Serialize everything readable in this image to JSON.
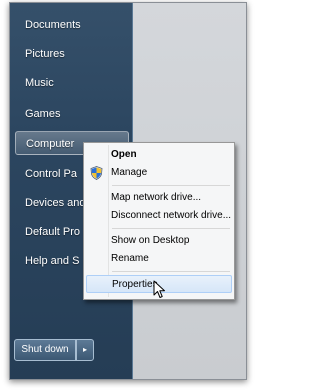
{
  "start_menu": {
    "items": [
      {
        "label": "Documents"
      },
      {
        "label": "Pictures"
      },
      {
        "label": "Music"
      },
      {
        "label": "Games"
      },
      {
        "label": "Computer"
      },
      {
        "label": "Control Pa"
      },
      {
        "label": "Devices and"
      },
      {
        "label": "Default Pro"
      },
      {
        "label": "Help and S"
      }
    ],
    "shutdown_label": "Shut down",
    "shutdown_arrow": "▸"
  },
  "context_menu": {
    "open": "Open",
    "manage": "Manage",
    "map_drive": "Map network drive...",
    "disconnect_drive": "Disconnect network drive...",
    "show_on_desktop": "Show on Desktop",
    "rename": "Rename",
    "properties": "Properties"
  },
  "icons": {
    "manage_icon": "shield-icon",
    "cursor": "mouse-cursor-icon"
  },
  "colors": {
    "start_menu_bg": "#2c4660",
    "hover_highlight": "#d6e6f8",
    "hover_border": "#aecff7"
  }
}
